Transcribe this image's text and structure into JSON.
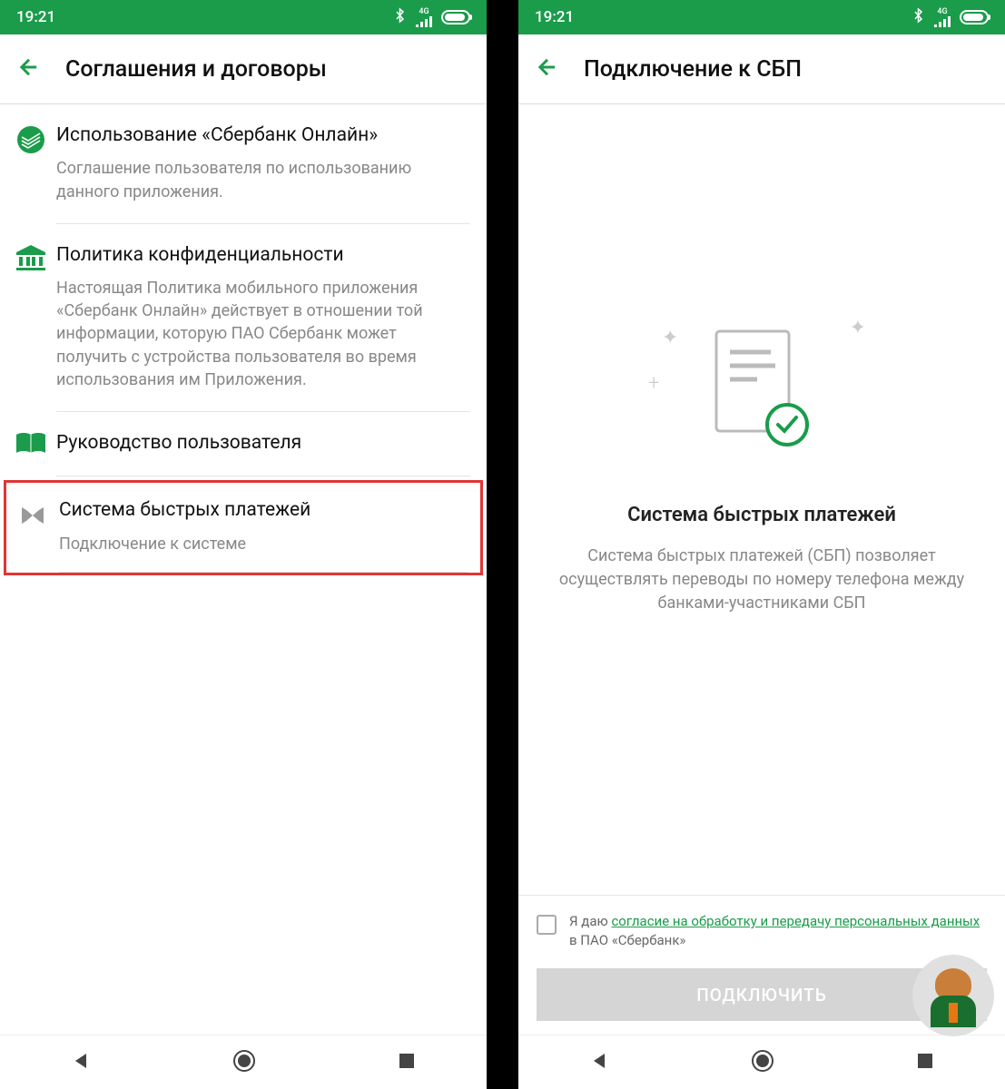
{
  "status": {
    "time": "19:21",
    "network": "4G"
  },
  "left": {
    "header": "Соглашения и договоры",
    "items": [
      {
        "title": "Использование «Сбербанк Онлайн»",
        "desc": "Соглашение пользователя по использованию данного приложения."
      },
      {
        "title": "Политика конфиденциальности",
        "desc": "Настоящая Политика мобильного приложения «Сбербанк Онлайн» действует в отношении той информации, которую ПАО Сбербанк может получить с устройства пользователя во время использования им Приложения."
      },
      {
        "title": "Руководство пользователя"
      },
      {
        "title": "Система быстрых платежей",
        "desc": "Подключение к системе"
      }
    ]
  },
  "right": {
    "header": "Подключение к СБП",
    "title": "Система быстрых платежей",
    "desc": "Система быстрых платежей (СБП) позволяет осуществлять переводы по номеру телефона между банками-участниками СБП",
    "consent_prefix": "Я даю ",
    "consent_link": "согласие на обработку и передачу персональных данных",
    "consent_suffix": " в ПАО «Сбербанк»",
    "button": "ПОДКЛЮЧИТЬ"
  }
}
